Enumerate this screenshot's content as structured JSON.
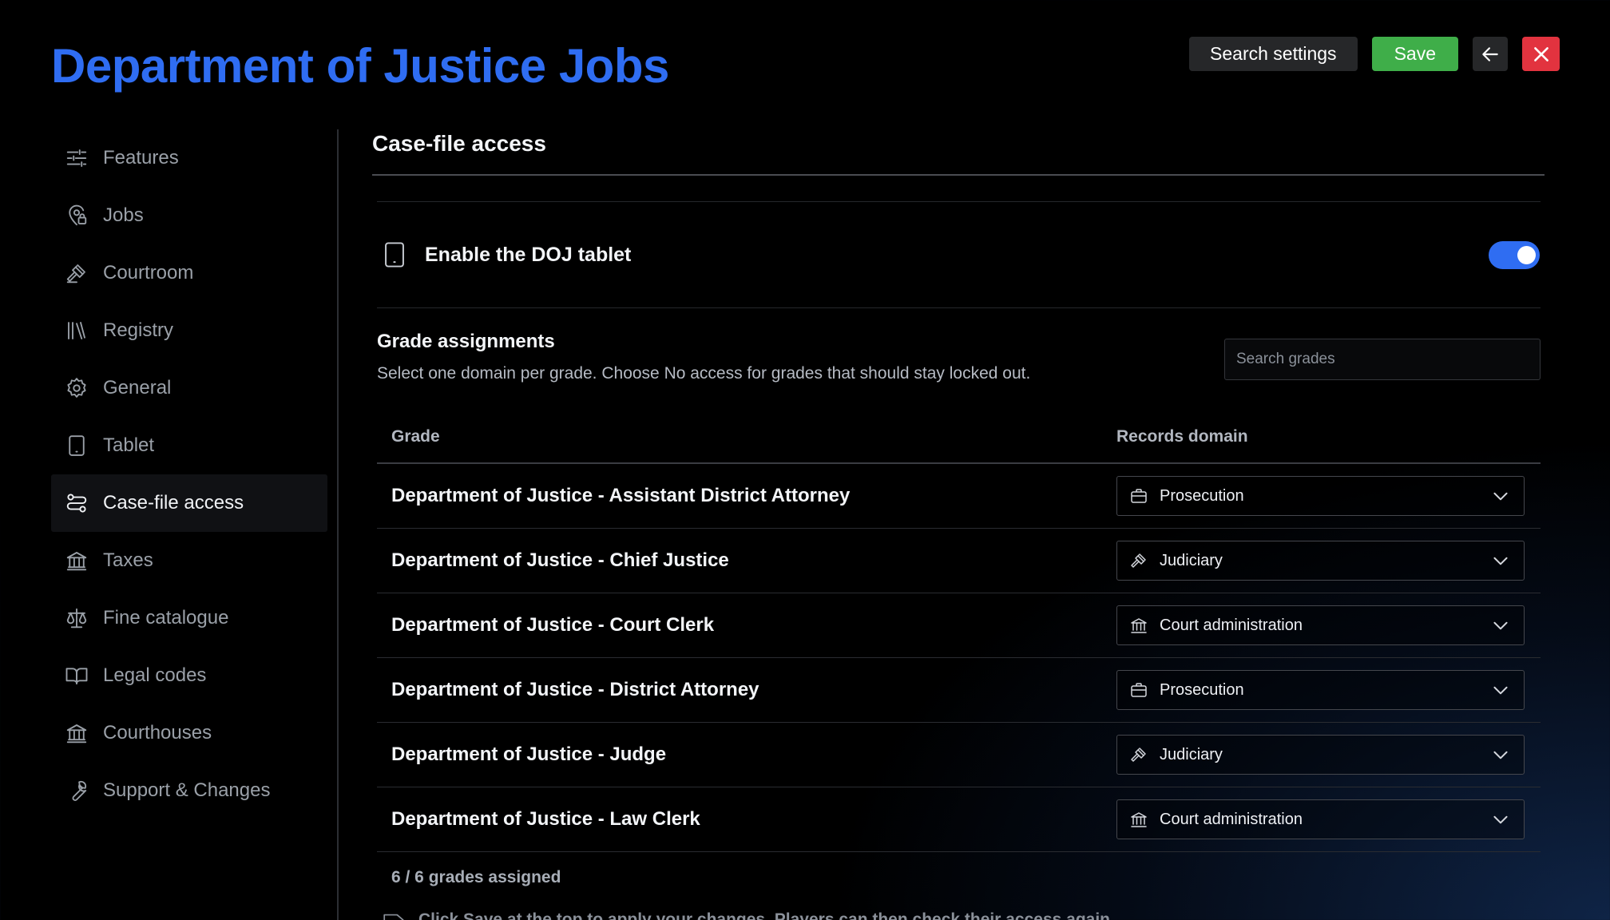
{
  "app": {
    "title": "Department of Justice Jobs"
  },
  "header": {
    "search_settings": "Search settings",
    "save": "Save"
  },
  "sidebar": {
    "items": [
      {
        "label": "Features",
        "icon": "sliders-icon"
      },
      {
        "label": "Jobs",
        "icon": "map-pin-lock-icon"
      },
      {
        "label": "Courtroom",
        "icon": "gavel-icon"
      },
      {
        "label": "Registry",
        "icon": "books-icon"
      },
      {
        "label": "General",
        "icon": "gear-icon"
      },
      {
        "label": "Tablet",
        "icon": "tablet-icon"
      },
      {
        "label": "Case-file access",
        "icon": "route-icon",
        "active": true
      },
      {
        "label": "Taxes",
        "icon": "bank-icon"
      },
      {
        "label": "Fine catalogue",
        "icon": "scale-icon"
      },
      {
        "label": "Legal codes",
        "icon": "book-open-icon"
      },
      {
        "label": "Courthouses",
        "icon": "courthouse-icon"
      },
      {
        "label": "Support & Changes",
        "icon": "wrench-icon"
      }
    ]
  },
  "main": {
    "section_title": "Case-file access",
    "toggle": {
      "label": "Enable the DOJ tablet",
      "on": true
    },
    "grades": {
      "title": "Grade assignments",
      "subtitle": "Select one domain per grade. Choose No access for grades that should stay locked out.",
      "search_placeholder": "Search grades",
      "col_grade": "Grade",
      "col_domain": "Records domain",
      "rows": [
        {
          "grade": "Department of Justice - Assistant District Attorney",
          "domain": "Prosecution",
          "icon": "briefcase-icon"
        },
        {
          "grade": "Department of Justice - Chief Justice",
          "domain": "Judiciary",
          "icon": "gavel-icon"
        },
        {
          "grade": "Department of Justice - Court Clerk",
          "domain": "Court administration",
          "icon": "courthouse-icon"
        },
        {
          "grade": "Department of Justice - District Attorney",
          "domain": "Prosecution",
          "icon": "briefcase-icon"
        },
        {
          "grade": "Department of Justice - Judge",
          "domain": "Judiciary",
          "icon": "gavel-icon"
        },
        {
          "grade": "Department of Justice - Law Clerk",
          "domain": "Court administration",
          "icon": "courthouse-icon"
        }
      ],
      "summary": "6 / 6 grades assigned",
      "hint": "Click Save at the top to apply your changes. Players can then check their access again."
    }
  },
  "colors": {
    "accent": "#2f6df2",
    "save": "#3fae49",
    "close": "#e2333f"
  }
}
